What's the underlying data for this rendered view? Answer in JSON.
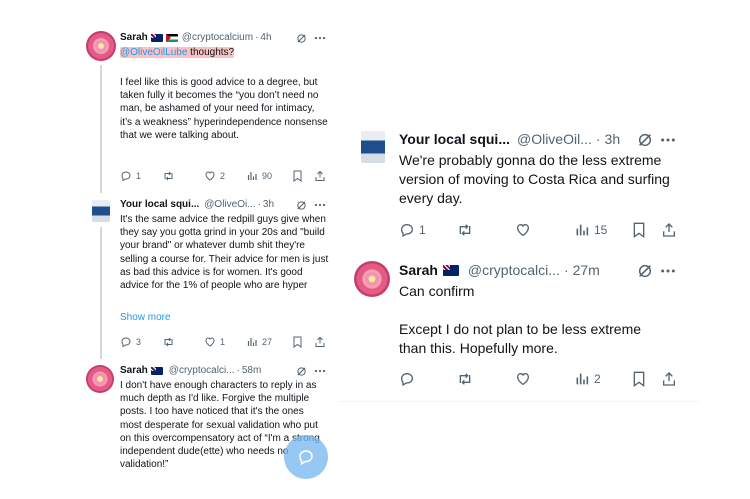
{
  "left": {
    "tweet1": {
      "name": "Sarah",
      "handle": "@cryptocalcium",
      "sep": "·",
      "time": "4h",
      "mention": "@OliveOilLube",
      "reply_rest": " thoughts?",
      "body": "I feel like this is good advice to a degree, but taken fully it becomes the “you don’t need no man, be ashamed of your need for intimacy, it’s a weakness” hyperindependence nonsense that we were talking about.",
      "replies": "1",
      "reposts": "",
      "likes": "2",
      "views": "90"
    },
    "tweet2": {
      "name": "Your local squi...",
      "handle": "@OliveOi...",
      "sep": "·",
      "time": "3h",
      "body": "It's the same advice the redpill guys give when they say you gotta grind in your 20s and \"build your brand\" or whatever dumb shit they're selling a course for. Their advice for men is just as bad this advice is for women. It's good advice for the 1% of people who are hyper",
      "show_more": "Show more",
      "replies": "3",
      "likes": "1",
      "views": "27"
    },
    "tweet3": {
      "name": "Sarah",
      "handle": "@cryptocalci...",
      "sep": "·",
      "time": "58m",
      "body": "I don't have enough characters to reply in as much depth as I'd like. Forgive the multiple posts. I too have noticed that it's the ones most desperate for sexual validation who put on this overcompensatory act of “I'm a strong independent dude(ette) who needs no validation!”"
    }
  },
  "right": {
    "tweet1": {
      "name": "Your local squi...",
      "handle": "@OliveOil...",
      "sep": "·",
      "time": "3h",
      "body": "We're probably gonna do the less extreme version of moving to Costa Rica and surfing every day.",
      "replies": "1",
      "views": "15"
    },
    "tweet2": {
      "name": "Sarah",
      "handle": "@cryptocalci...",
      "sep": "·",
      "time": "27m",
      "body_line1": "Can confirm",
      "body_line2": "Except I do not plan to be less extreme than this. Hopefully more.",
      "views": "2"
    }
  },
  "colors": {
    "accent": "#1d9bf0",
    "muted": "#536471",
    "text": "#0f1419",
    "highlight": "#f48f8f"
  }
}
